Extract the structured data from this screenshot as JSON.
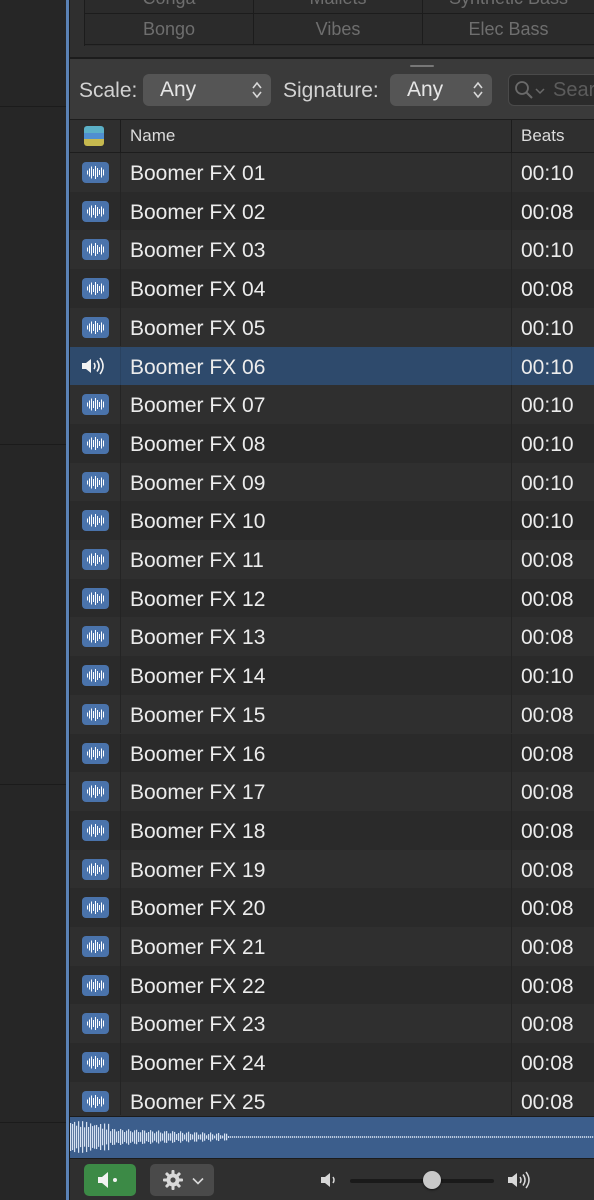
{
  "instruments": {
    "row1": [
      "Conga",
      "Mallets",
      "Synthetic Bass"
    ],
    "row2": [
      "Bongo",
      "Vibes",
      "Elec Bass"
    ]
  },
  "filters": {
    "scale_label": "Scale:",
    "scale_value": "Any",
    "signature_label": "Signature:",
    "signature_value": "Any",
    "search_placeholder": "Sear"
  },
  "columns": {
    "name": "Name",
    "beats": "Beats"
  },
  "selected_index": 5,
  "rows": [
    {
      "name": "Boomer FX 01",
      "beats": "00:10"
    },
    {
      "name": "Boomer FX 02",
      "beats": "00:08"
    },
    {
      "name": "Boomer FX 03",
      "beats": "00:10"
    },
    {
      "name": "Boomer FX 04",
      "beats": "00:08"
    },
    {
      "name": "Boomer FX 05",
      "beats": "00:10"
    },
    {
      "name": "Boomer FX 06",
      "beats": "00:10"
    },
    {
      "name": "Boomer FX 07",
      "beats": "00:10"
    },
    {
      "name": "Boomer FX 08",
      "beats": "00:10"
    },
    {
      "name": "Boomer FX 09",
      "beats": "00:10"
    },
    {
      "name": "Boomer FX 10",
      "beats": "00:10"
    },
    {
      "name": "Boomer FX 11",
      "beats": "00:08"
    },
    {
      "name": "Boomer FX 12",
      "beats": "00:08"
    },
    {
      "name": "Boomer FX 13",
      "beats": "00:08"
    },
    {
      "name": "Boomer FX 14",
      "beats": "00:10"
    },
    {
      "name": "Boomer FX 15",
      "beats": "00:08"
    },
    {
      "name": "Boomer FX 16",
      "beats": "00:08"
    },
    {
      "name": "Boomer FX 17",
      "beats": "00:08"
    },
    {
      "name": "Boomer FX 18",
      "beats": "00:08"
    },
    {
      "name": "Boomer FX 19",
      "beats": "00:08"
    },
    {
      "name": "Boomer FX 20",
      "beats": "00:08"
    },
    {
      "name": "Boomer FX 21",
      "beats": "00:08"
    },
    {
      "name": "Boomer FX 22",
      "beats": "00:08"
    },
    {
      "name": "Boomer FX 23",
      "beats": "00:08"
    },
    {
      "name": "Boomer FX 24",
      "beats": "00:08"
    },
    {
      "name": "Boomer FX 25",
      "beats": "00:08"
    }
  ],
  "volume": {
    "level": 0.57
  },
  "icons": {
    "row_icon": "audio-waveform-icon",
    "selected_icon": "speaker-playing-icon",
    "preview": "speaker-icon",
    "settings": "gear-icon",
    "chevron": "chevron-down-icon",
    "volume_low": "volume-low-icon",
    "volume_high": "volume-high-icon",
    "search": "search-icon"
  },
  "colors": {
    "selection": "#2e4a6c",
    "accent_blue": "#4a73ab",
    "preview_green": "#3c8a46"
  }
}
